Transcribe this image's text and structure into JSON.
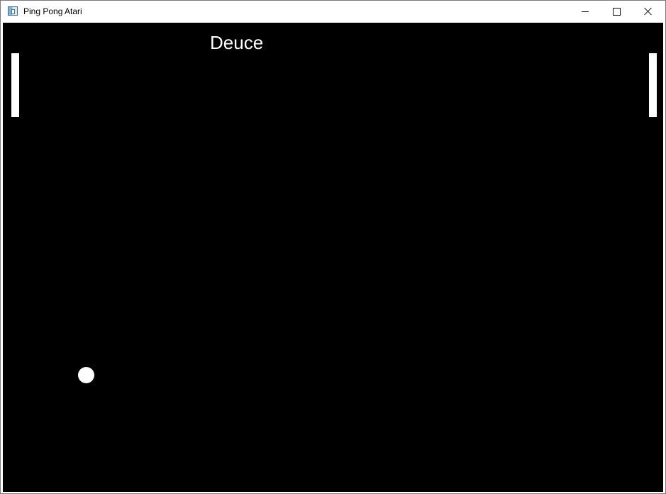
{
  "window": {
    "title": "Ping Pong Atari",
    "icon": "window-app-icon",
    "controls": [
      {
        "name": "minimize",
        "icon": "minimize-icon"
      },
      {
        "name": "maximize",
        "icon": "maximize-icon"
      },
      {
        "name": "close",
        "icon": "close-icon"
      }
    ]
  },
  "game": {
    "score_status": "Deuce",
    "background_color": "#000000",
    "foreground_color": "#ffffff"
  }
}
